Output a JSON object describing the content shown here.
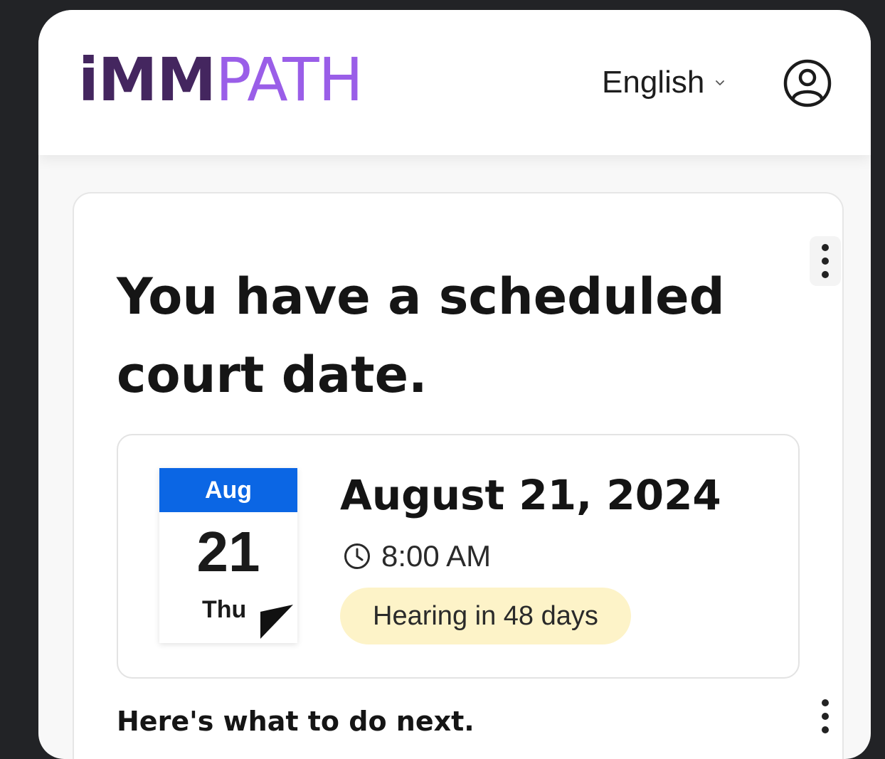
{
  "header": {
    "logo_bold": "iMM",
    "logo_light": "PATH",
    "language": "English",
    "language_icon": "chevron-down-icon",
    "profile_icon": "user-circle-icon"
  },
  "card": {
    "headline": "You have a scheduled court date.",
    "menu_icon": "more-vertical-icon",
    "calendar": {
      "month": "Aug",
      "day": "21",
      "weekday": "Thu"
    },
    "date_title": "August 21, 2024",
    "time_icon": "clock-icon",
    "time": "8:00 AM",
    "badge": "Hearing in 48 days",
    "next_steps": "Here's what to do next."
  },
  "colors": {
    "logo_bold": "#44265f",
    "logo_light": "#9a5ee8",
    "calendar_month_bg": "#0b66e4",
    "badge_bg": "#fdf3c8"
  }
}
